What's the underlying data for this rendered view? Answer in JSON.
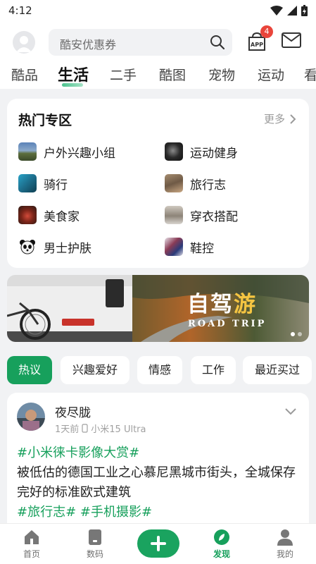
{
  "status": {
    "time": "4:12"
  },
  "search": {
    "placeholder": "酷安优惠券"
  },
  "header": {
    "app_badge": "4"
  },
  "tabs": [
    {
      "label": "酷品"
    },
    {
      "label": "生活"
    },
    {
      "label": "二手"
    },
    {
      "label": "酷图"
    },
    {
      "label": "宠物"
    },
    {
      "label": "运动"
    },
    {
      "label": "看"
    }
  ],
  "hot": {
    "title": "热门专区",
    "more": "更多",
    "items": [
      {
        "label": "户外兴趣小组"
      },
      {
        "label": "运动健身"
      },
      {
        "label": "骑行"
      },
      {
        "label": "旅行志"
      },
      {
        "label": "美食家"
      },
      {
        "label": "穿衣搭配"
      },
      {
        "label": "男士护肤"
      },
      {
        "label": "鞋控"
      }
    ]
  },
  "banner": {
    "title_white": "自驾",
    "title_yellow": "游",
    "subtitle": "ROAD TRIP"
  },
  "chips": [
    {
      "label": "热议"
    },
    {
      "label": "兴趣爱好"
    },
    {
      "label": "情感"
    },
    {
      "label": "工作"
    },
    {
      "label": "最近买过"
    }
  ],
  "post": {
    "author": "夜尽胧",
    "time": "1天前",
    "device": "小米15 Ultra",
    "tag1": "#小米徕卡影像大赏#",
    "text": "被低估的德国工业之心慕尼黑城市街头，全城保存完好的标准欧式建筑",
    "tag2": "#旅行志#",
    "tag3": "#手机摄影#"
  },
  "nav": [
    {
      "label": "首页"
    },
    {
      "label": "数码"
    },
    {
      "label": "发现"
    },
    {
      "label": "我的"
    }
  ],
  "colors": {
    "accent": "#17a05c",
    "badge": "#e9453b"
  }
}
